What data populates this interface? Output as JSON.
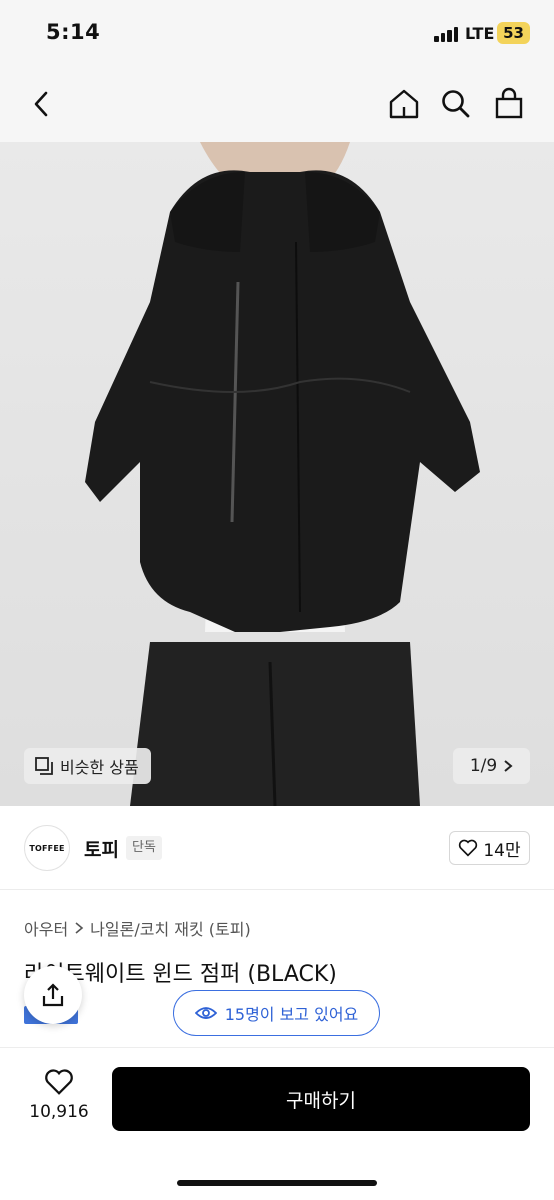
{
  "status_bar": {
    "time": "5:14",
    "network": "LTE",
    "battery": "53",
    "battery_color": "#f3d35a"
  },
  "nav": {
    "back_icon": "chevron-left-icon",
    "home_icon": "home-icon",
    "search_icon": "search-icon",
    "cart_icon": "shopping-bag-icon"
  },
  "gallery": {
    "similar_label": "비슷한 상품",
    "counter": "1/9"
  },
  "brand": {
    "logo_text": "TOFFEE",
    "name": "토피",
    "tag": "단독",
    "likes": "14만"
  },
  "product": {
    "breadcrumb": [
      "아우터",
      "나일론/코치 재킷 (토피)"
    ],
    "title": "라이트웨이트 윈드 점퍼 (BLACK)",
    "viewers": "15명이 보고 있어요",
    "accent_color": "#3b6fe0"
  },
  "bottom_bar": {
    "wish_count": "10,916",
    "buy_label": "구매하기"
  }
}
